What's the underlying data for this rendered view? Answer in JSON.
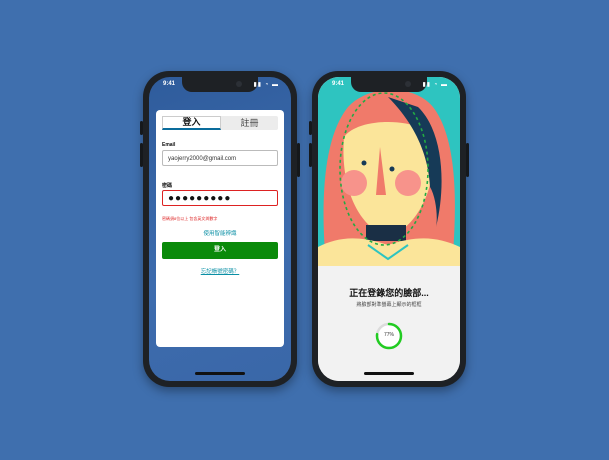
{
  "left_phone": {
    "status_time": "9:41",
    "status_icons": "▮▮ ◔ ▬",
    "tabs": [
      {
        "label": "登入",
        "active": true
      },
      {
        "label": "註冊",
        "active": false
      }
    ],
    "email_label": "Email",
    "email_value": "yaojerry2000@gmail.com",
    "password_label": "密碼",
    "password_value": "●●●●●●●●●",
    "password_error": "密碼須8位以上 包含英文與數字",
    "smart_phone_link": "使用智能辨識",
    "login_button": "登入",
    "forgot_link": "忘記帳號密碼？"
  },
  "right_phone": {
    "status_time": "9:41",
    "status_icons": "▮▮ ◔ ▬",
    "scan_title": "正在登錄您的臉部...",
    "scan_subtitle": "將臉部對準螢幕上顯示的框框",
    "progress_label": "77%",
    "progress": 0.77
  },
  "colors": {
    "background": "#3f6fae",
    "accent": "#0a8a0a",
    "link": "#0a8fa5",
    "error": "#dd2222",
    "progress": "#22cc22"
  }
}
